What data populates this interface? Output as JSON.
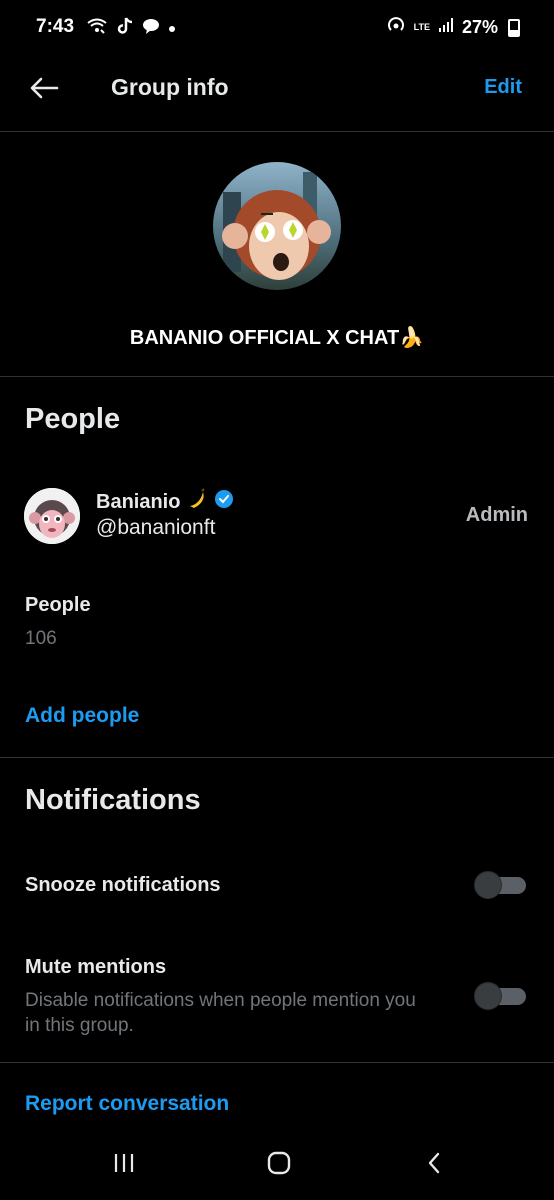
{
  "status_bar": {
    "time": "7:43",
    "network": "LTE",
    "battery": "27%",
    "icons": [
      "wifi-calling-icon",
      "tiktok-icon",
      "chat-bubble-icon",
      "dot-icon",
      "hotspot-icon",
      "signal-icon",
      "battery-icon"
    ]
  },
  "header": {
    "title": "Group info",
    "edit_label": "Edit",
    "back_icon": "arrow-left-icon"
  },
  "group": {
    "name": "BANANIO OFFICIAL X CHAT🍌"
  },
  "people_section": {
    "title": "People",
    "member": {
      "name": "Banianio",
      "handle": "@bananionft",
      "role": "Admin",
      "verified": true
    },
    "count_label": "People",
    "count": "106",
    "add_label": "Add people"
  },
  "notifications_section": {
    "title": "Notifications",
    "snooze_label": "Snooze notifications",
    "snooze_on": false,
    "mute_label": "Mute mentions",
    "mute_desc": "Disable notifications when people mention you in this group.",
    "mute_on": false
  },
  "report_label": "Report conversation",
  "colors": {
    "accent": "#1d9bf0",
    "background": "#000000",
    "divider": "#2f3336",
    "secondary_text": "#71767b"
  }
}
